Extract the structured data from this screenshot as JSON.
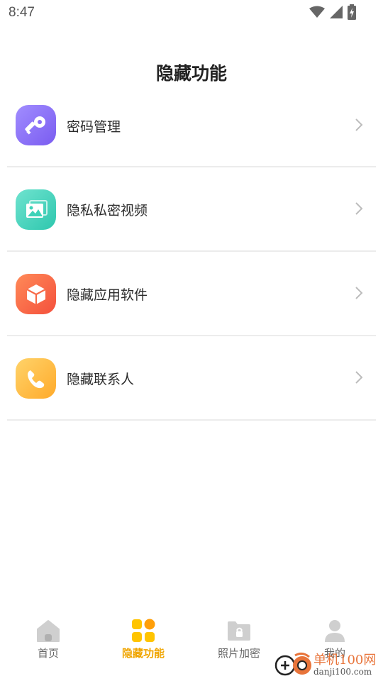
{
  "status_bar": {
    "time": "8:47"
  },
  "page_title": "隐藏功能",
  "menu": [
    {
      "label": "密码管理",
      "icon": "key-icon",
      "color": "#8b6ff5"
    },
    {
      "label": "隐私私密视频",
      "icon": "photo-icon",
      "color": "#3dd2b8"
    },
    {
      "label": "隐藏应用软件",
      "icon": "box-icon",
      "color": "#f86a48"
    },
    {
      "label": "隐藏联系人",
      "icon": "phone-icon",
      "color": "#ffbb3d"
    }
  ],
  "tabs": [
    {
      "label": "首页",
      "icon": "home-icon",
      "active": false
    },
    {
      "label": "隐藏功能",
      "icon": "grid-icon",
      "active": true
    },
    {
      "label": "照片加密",
      "icon": "locked-folder-icon",
      "active": false
    },
    {
      "label": "我的",
      "icon": "person-icon",
      "active": false
    }
  ],
  "colors": {
    "accent": "#f0a500"
  },
  "watermark": {
    "line1": "单机100网",
    "line2": "danji100.com"
  }
}
